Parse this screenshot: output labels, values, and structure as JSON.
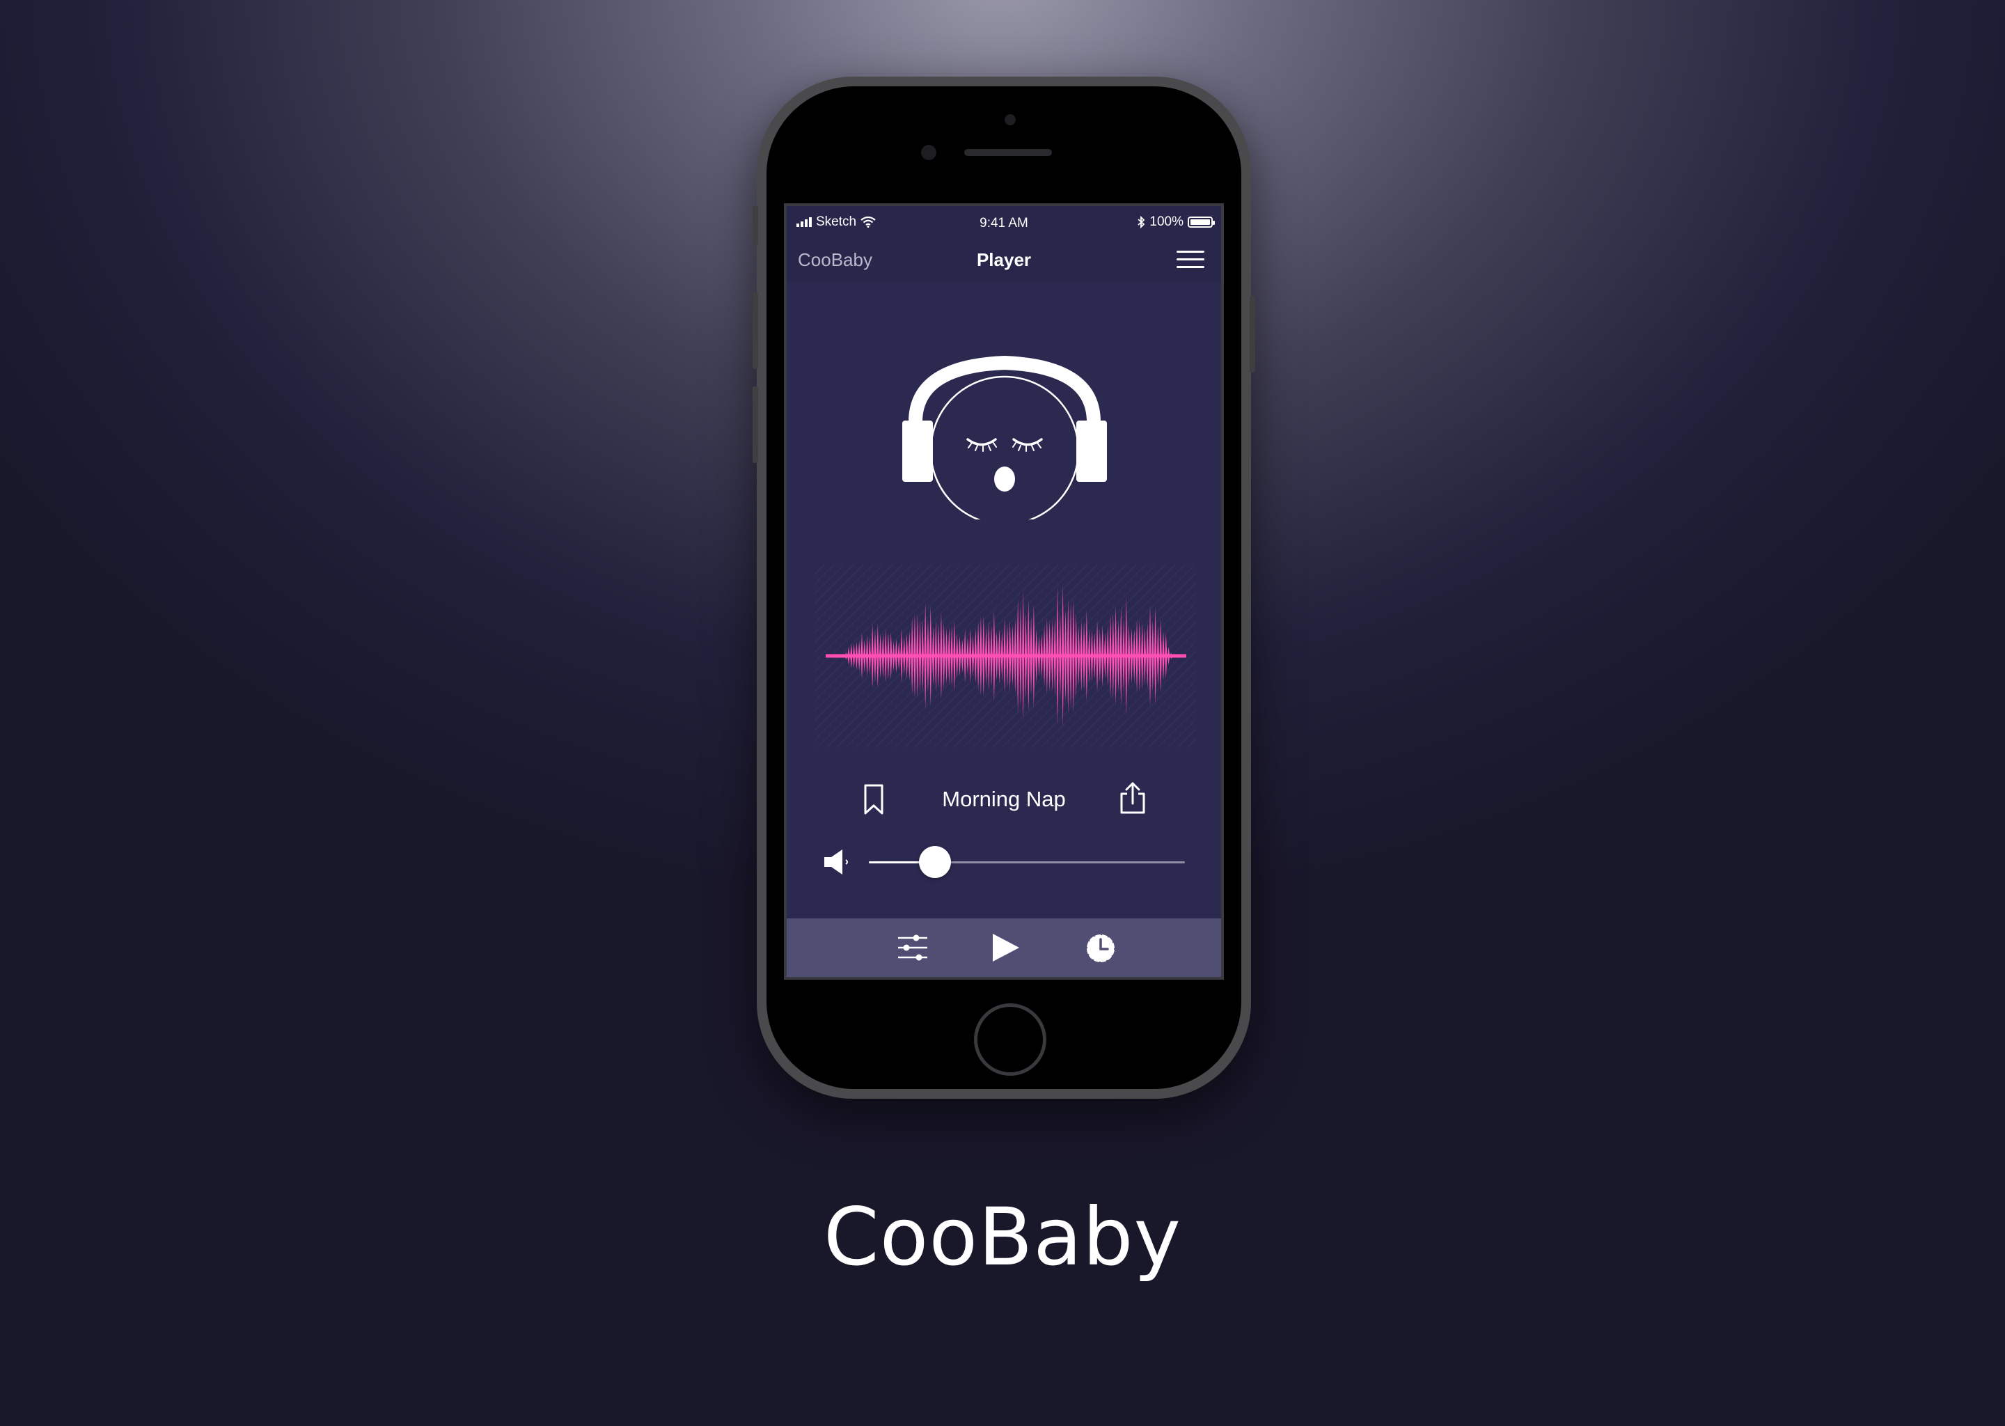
{
  "status_bar": {
    "carrier": "Sketch",
    "time": "9:41 AM",
    "battery": "100%",
    "icons": [
      "signal-bars-icon",
      "wifi-icon",
      "bluetooth-icon",
      "battery-icon"
    ]
  },
  "nav": {
    "left_label": "CooBaby",
    "title": "Player",
    "menu_icon": "hamburger-menu-icon"
  },
  "artwork": {
    "icon": "sleeping-baby-headphones-icon"
  },
  "waveform": {
    "color": "#ff4fb4",
    "icon": "audio-waveform"
  },
  "track": {
    "title": "Morning Nap",
    "bookmark_icon": "bookmark-icon",
    "share_icon": "share-icon"
  },
  "volume": {
    "icon": "speaker-icon",
    "level": 0.21
  },
  "tab_bar": {
    "items": [
      {
        "icon": "equalizer-sliders-icon"
      },
      {
        "icon": "play-icon"
      },
      {
        "icon": "timer-clock-icon"
      }
    ]
  },
  "colors": {
    "screen_background": "#2b2950",
    "nav_background": "#28264a",
    "tab_bar_background": "#514e73",
    "accent": "#ff4fb4"
  },
  "caption": "CooBaby"
}
